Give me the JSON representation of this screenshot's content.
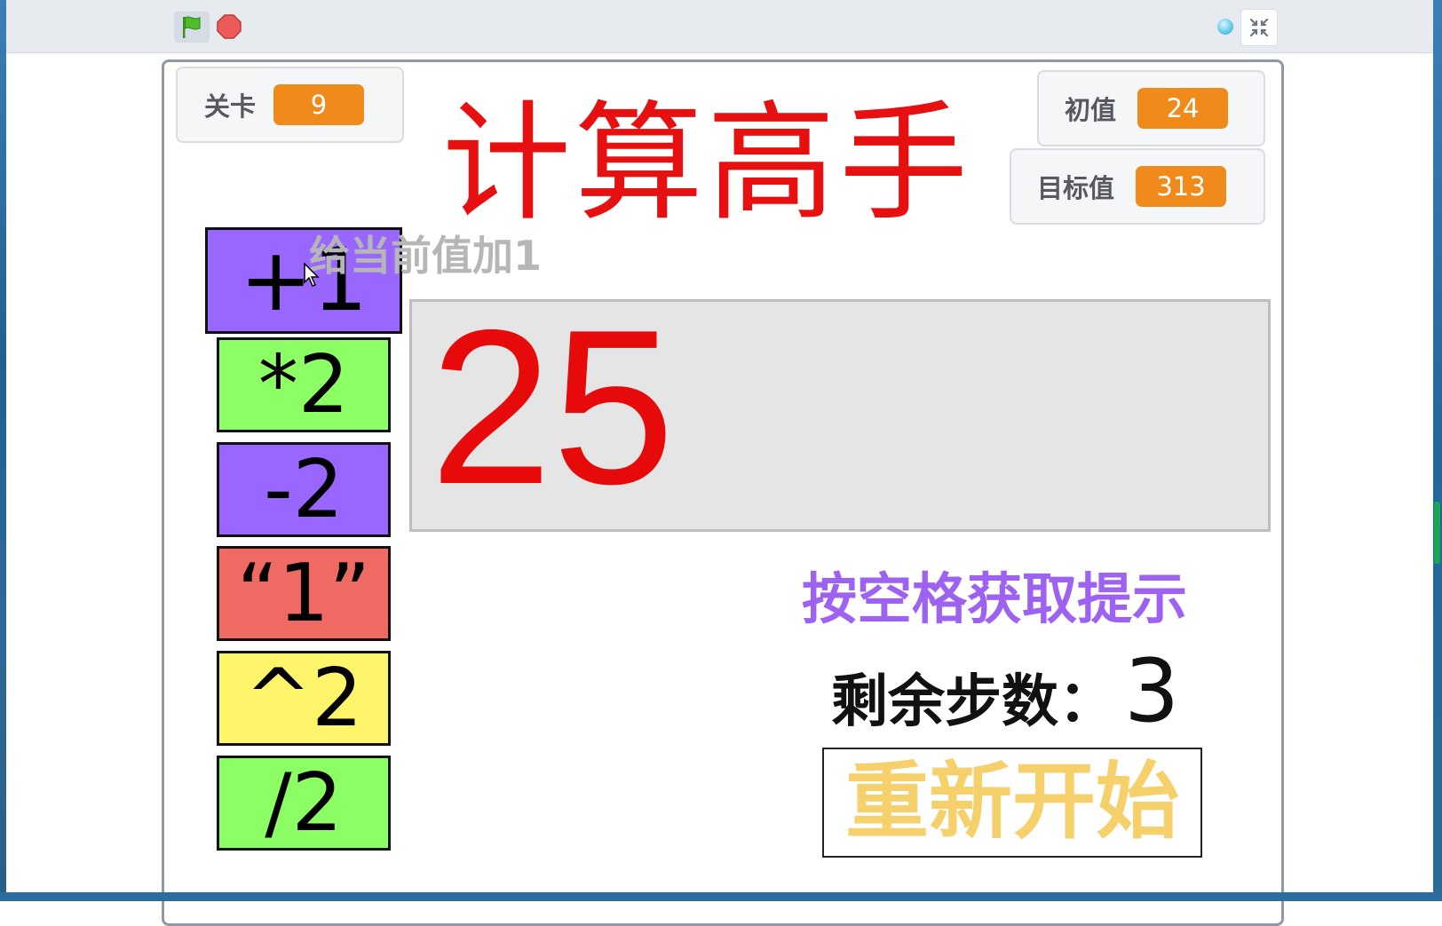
{
  "toolbar": {
    "flag_icon": "green-flag-icon",
    "stop_icon": "stop-sign-icon",
    "turbo_icon": "turbo-dot-icon",
    "fullscreen_icon": "exit-fullscreen-icon"
  },
  "monitors": {
    "level": {
      "label": "关卡",
      "value": "9"
    },
    "initial": {
      "label": "初值",
      "value": "24"
    },
    "target": {
      "label": "目标值",
      "value": "313"
    }
  },
  "title": "计算高手",
  "tooltip": "给当前值加1",
  "operations": [
    {
      "label": "+1",
      "color": "#9966ff"
    },
    {
      "label": "*2",
      "color": "#8cff64"
    },
    {
      "label": "-2",
      "color": "#9966ff"
    },
    {
      "label": "“1”",
      "color": "#f06a64"
    },
    {
      "label": "^2",
      "color": "#fff56a"
    },
    {
      "label": "/2",
      "color": "#8cff64"
    }
  ],
  "current_value": "25",
  "hint": "按空格获取提示",
  "steps": {
    "label": "剩余步数：",
    "value": "3"
  },
  "restart_label": "重新开始",
  "colors": {
    "title": "#e61010",
    "current_value": "#e60a0a",
    "hint": "#9d63f0",
    "restart": "#f6d06a",
    "monitor_value_bg": "#f08a1a"
  }
}
